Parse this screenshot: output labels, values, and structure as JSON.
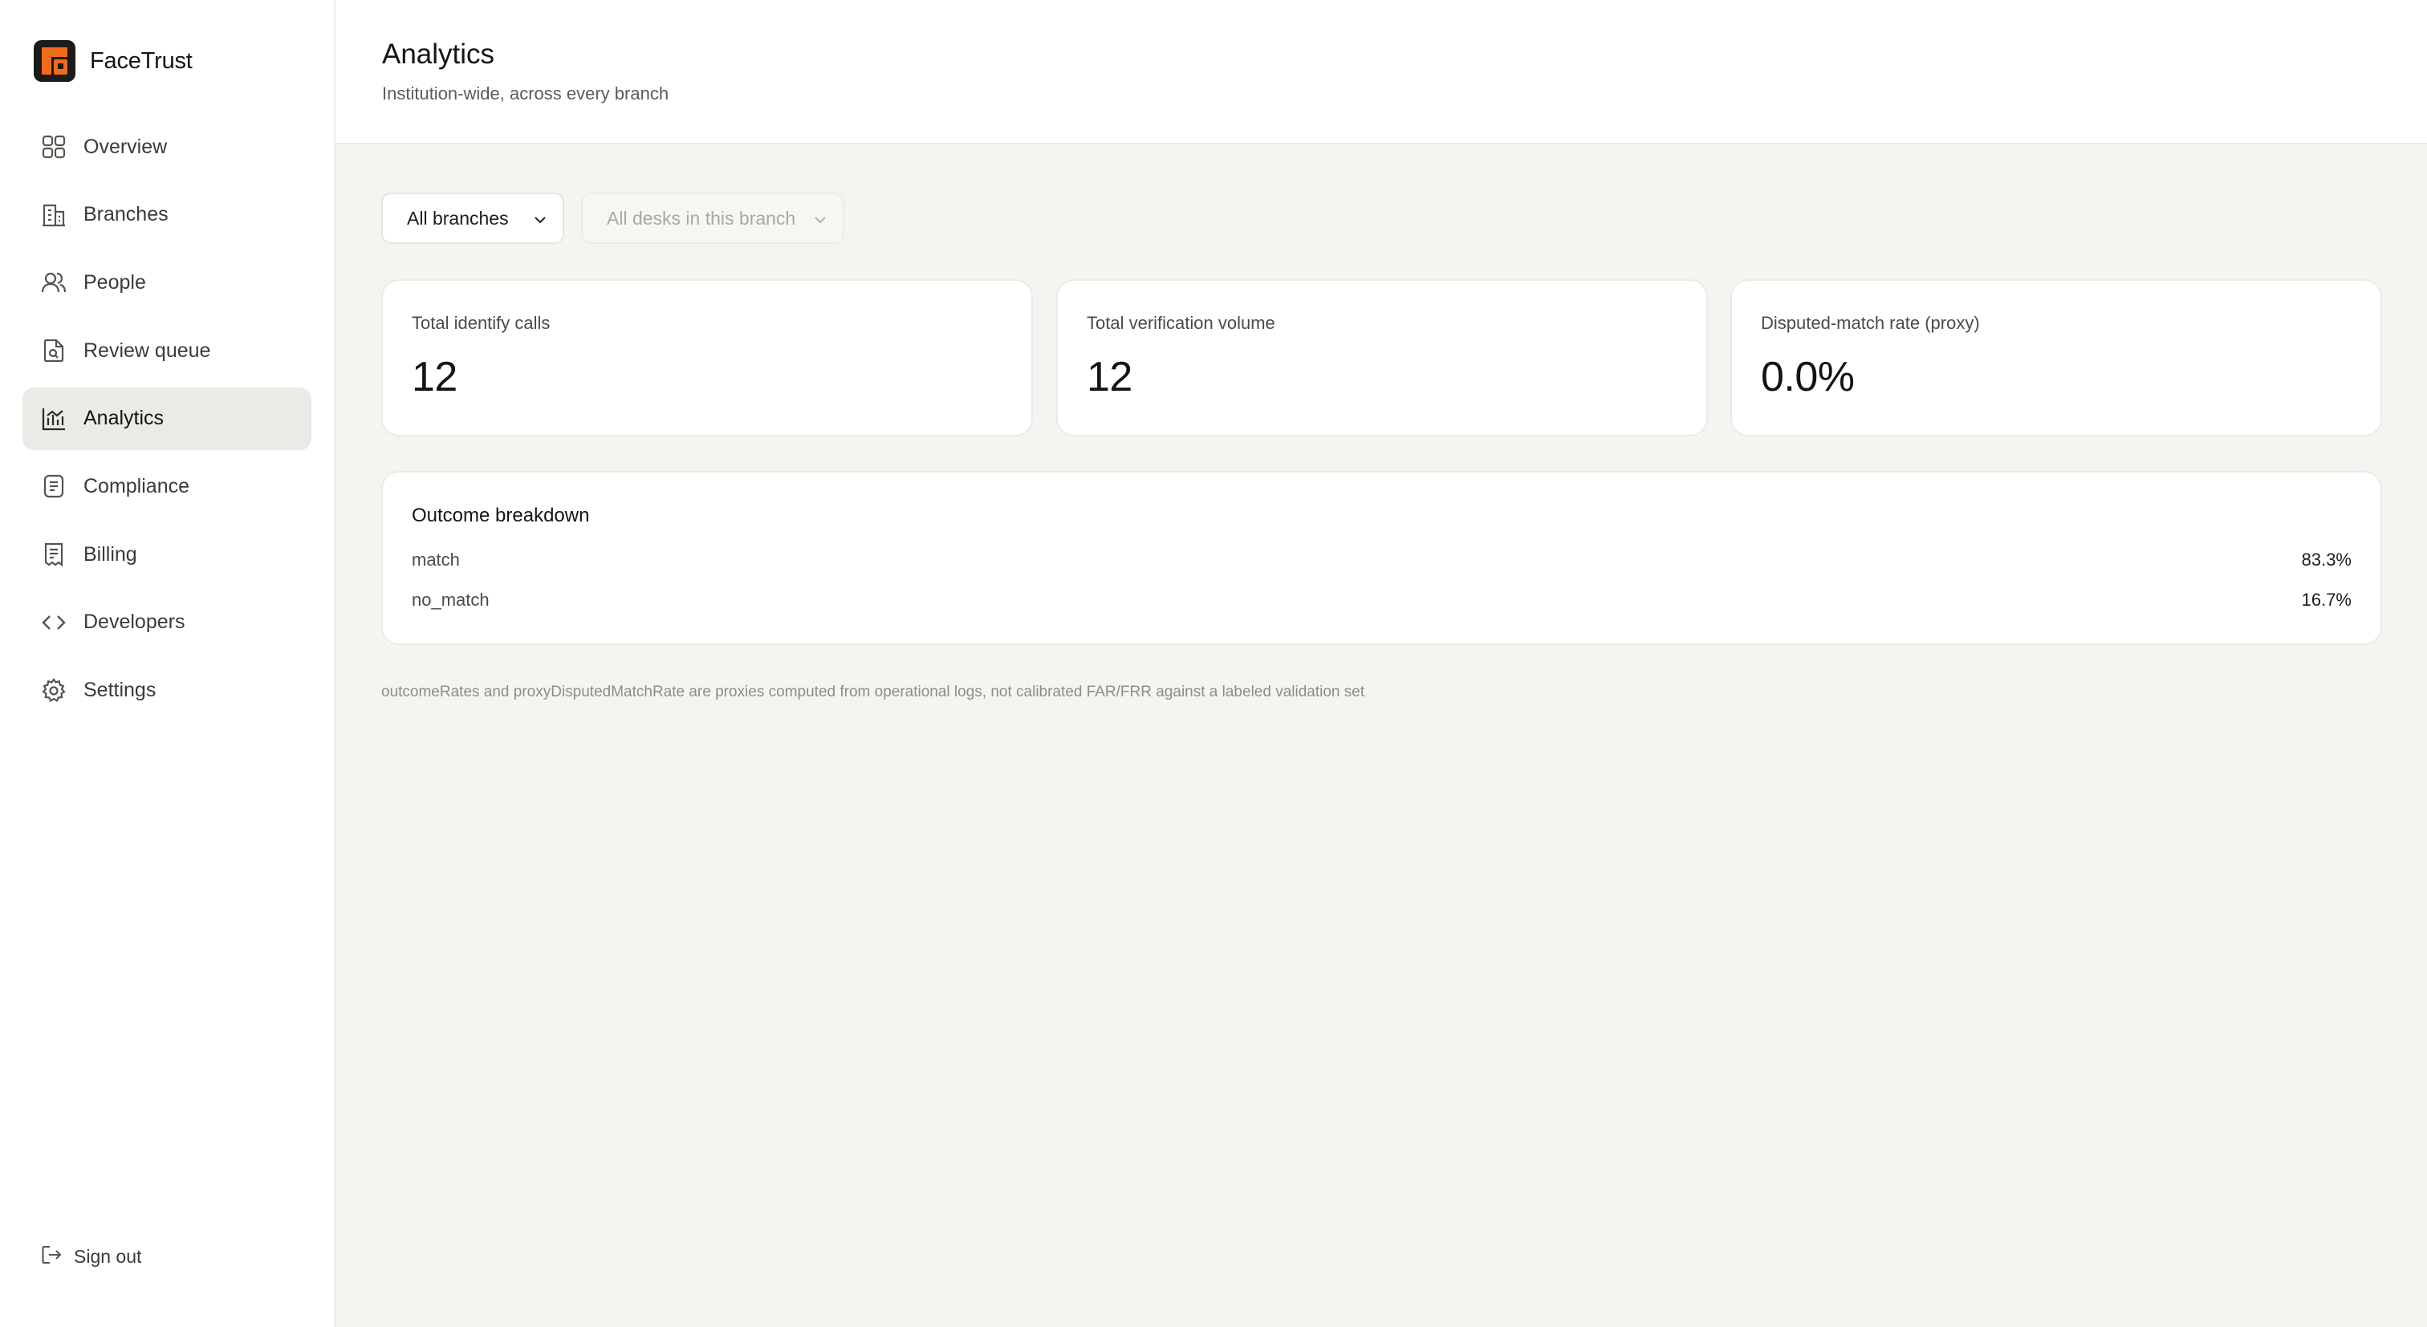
{
  "app": {
    "name": "FaceTrust",
    "logo_icon": "facetrust-logo-icon",
    "accent_color": "#f26a1b"
  },
  "sidebar": {
    "items": [
      {
        "label": "Overview",
        "icon": "grid-icon",
        "active": false
      },
      {
        "label": "Branches",
        "icon": "building-icon",
        "active": false
      },
      {
        "label": "People",
        "icon": "users-icon",
        "active": false
      },
      {
        "label": "Review queue",
        "icon": "file-search-icon",
        "active": false
      },
      {
        "label": "Analytics",
        "icon": "bar-chart-icon",
        "active": true
      },
      {
        "label": "Compliance",
        "icon": "document-icon",
        "active": false
      },
      {
        "label": "Billing",
        "icon": "receipt-icon",
        "active": false
      },
      {
        "label": "Developers",
        "icon": "code-icon",
        "active": false
      },
      {
        "label": "Settings",
        "icon": "gear-icon",
        "active": false
      }
    ],
    "signout_label": "Sign out"
  },
  "header": {
    "title": "Analytics",
    "subtitle": "Institution-wide, across every branch"
  },
  "filters": {
    "branch_select": {
      "value": "All branches"
    },
    "desk_select": {
      "value": "All desks in this branch",
      "disabled": true
    }
  },
  "stats": [
    {
      "label": "Total identify calls",
      "value": "12"
    },
    {
      "label": "Total verification volume",
      "value": "12"
    },
    {
      "label": "Disputed-match rate (proxy)",
      "value": "0.0%"
    }
  ],
  "breakdown": {
    "title": "Outcome breakdown",
    "rows": [
      {
        "name": "match",
        "value": "83.3%"
      },
      {
        "name": "no_match",
        "value": "16.7%"
      }
    ]
  },
  "footnote": "outcomeRates and proxyDisputedMatchRate are proxies computed from operational logs, not calibrated FAR/FRR against a labeled validation set"
}
